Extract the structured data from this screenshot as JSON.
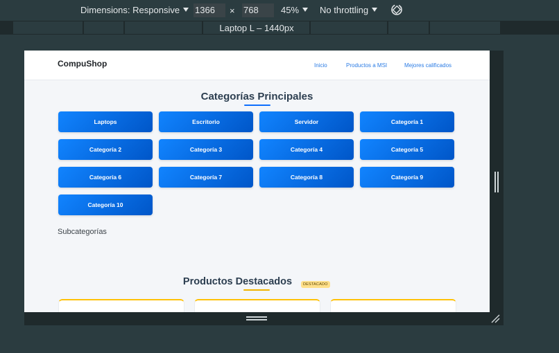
{
  "devtools": {
    "dimensions_label": "Dimensions: Responsive",
    "width_value": "1366",
    "times": "×",
    "height_value": "768",
    "zoom_label": "45%",
    "throttling_label": "No throttling",
    "device_label": "Laptop L – 1440px"
  },
  "site": {
    "brand": "CompuShop",
    "nav": [
      "Inicio",
      "Productos a MSI",
      "Mejores calificados"
    ],
    "categories_title": "Categorías Principales",
    "categories": [
      "Laptops",
      "Escritorio",
      "Servidor",
      "Categoría 1",
      "Categoría 2",
      "Categoría 3",
      "Categoría 4",
      "Categoría 5",
      "Categoría 6",
      "Categoría 7",
      "Categoría 8",
      "Categoría 9",
      "Categoría 10"
    ],
    "subcategories_title": "Subcategorías",
    "featured_title": "Productos Destacados",
    "featured_badge": "DESTACADO"
  },
  "colors": {
    "accent": "#0d6efd",
    "card_border": "#ffc107"
  }
}
